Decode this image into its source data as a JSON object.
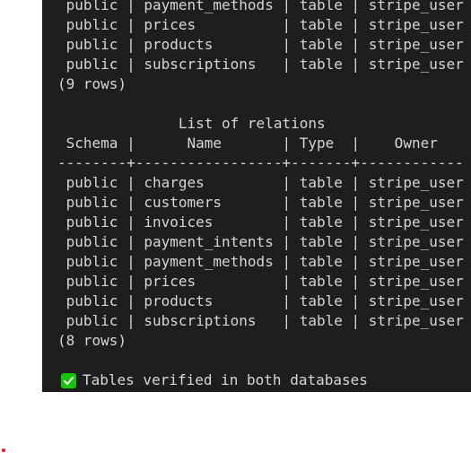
{
  "colors": {
    "terminal_bg": "#1e1e1e",
    "terminal_fg": "#d6d6d6",
    "check_green": "#16c60c",
    "dot_red": "#e81123"
  },
  "terminal": {
    "top_rows": [
      " public | payment_methods | table | stripe_user",
      " public | prices          | table | stripe_user",
      " public | products        | table | stripe_user",
      " public | subscriptions   | table | stripe_user"
    ],
    "top_footer": "(9 rows)",
    "second": {
      "title": "              List of relations",
      "header": " Schema |      Name       | Type  |    Owner",
      "separator": "--------+-----------------+-------+------------",
      "rows": [
        " public | charges         | table | stripe_user",
        " public | customers       | table | stripe_user",
        " public | invoices        | table | stripe_user",
        " public | payment_intents | table | stripe_user",
        " public | payment_methods | table | stripe_user",
        " public | prices          | table | stripe_user",
        " public | products        | table | stripe_user",
        " public | subscriptions   | table | stripe_user"
      ],
      "footer": "(8 rows)"
    },
    "verified_icon": "check-mark-icon",
    "verified_text": "Tables verified in both databases"
  }
}
